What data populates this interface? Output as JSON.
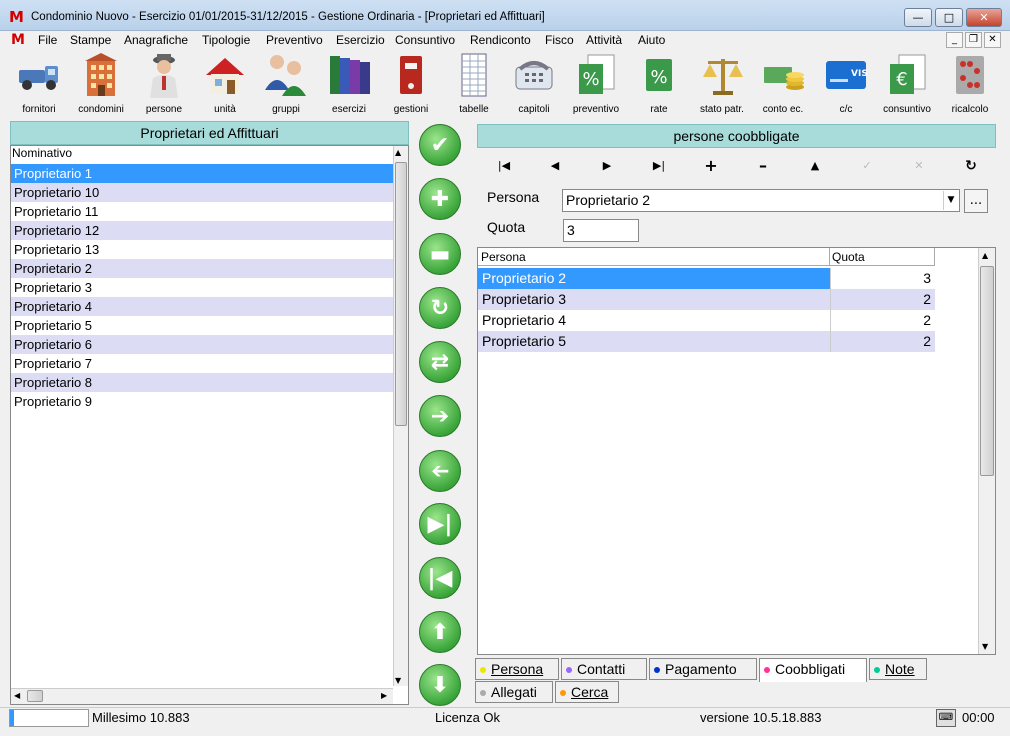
{
  "window": {
    "title": "Condominio Nuovo - Esercizio 01/01/2015-31/12/2015 - Gestione Ordinaria - [Proprietari ed Affittuari]",
    "logo": "M"
  },
  "menu": {
    "items": [
      "File",
      "Stampe",
      "Anagrafiche",
      "Tipologie",
      "Preventivo",
      "Esercizio",
      "Consuntivo",
      "Rendiconto",
      "Fisco",
      "Attività",
      "Aiuto"
    ]
  },
  "toolbar": {
    "items": [
      {
        "label": "fornitori",
        "icon": "truck-icon"
      },
      {
        "label": "condomini",
        "icon": "building-icon"
      },
      {
        "label": "persone",
        "icon": "person-icon"
      },
      {
        "label": "unità",
        "icon": "house-icon"
      },
      {
        "label": "gruppi",
        "icon": "group-icon"
      },
      {
        "label": "esercizi",
        "icon": "books-icon"
      },
      {
        "label": "gestioni",
        "icon": "binder-icon"
      },
      {
        "label": "tabelle",
        "icon": "table-icon"
      },
      {
        "label": "capitoli",
        "icon": "phone-icon"
      },
      {
        "label": "preventivo",
        "icon": "percent-doc-icon"
      },
      {
        "label": "rate",
        "icon": "percent-icon"
      },
      {
        "label": "stato patr.",
        "icon": "scale-icon"
      },
      {
        "label": "conto ec.",
        "icon": "coins-icon"
      },
      {
        "label": "c/c",
        "icon": "visa-card-icon"
      },
      {
        "label": "consuntivo",
        "icon": "euro-doc-icon"
      },
      {
        "label": "ricalcolo",
        "icon": "abacus-icon"
      }
    ]
  },
  "left_panel": {
    "title": "Proprietari ed Affittuari",
    "column_header": "Nominativo",
    "rows": [
      "Proprietario 1",
      "Proprietario 10",
      "Proprietario 11",
      "Proprietario 12",
      "Proprietario 13",
      "Proprietario 2",
      "Proprietario 3",
      "Proprietario 4",
      "Proprietario 5",
      "Proprietario 6",
      "Proprietario 7",
      "Proprietario 8",
      "Proprietario 9"
    ]
  },
  "right_panel": {
    "title": "persone coobbligate",
    "persona_label": "Persona",
    "persona_value": "Proprietario 2",
    "browse_label": "...",
    "quota_label": "Quota",
    "quota_value": "3",
    "grid": {
      "headers": [
        "Persona",
        "Quota"
      ],
      "rows": [
        {
          "persona": "Proprietario 2",
          "quota": "3"
        },
        {
          "persona": "Proprietario 3",
          "quota": "2"
        },
        {
          "persona": "Proprietario 4",
          "quota": "2"
        },
        {
          "persona": "Proprietario 5",
          "quota": "2"
        }
      ]
    }
  },
  "tabs": {
    "row1": [
      {
        "label": "Persona",
        "color": "#e8e800"
      },
      {
        "label": "Contatti",
        "color": "#9966ff"
      },
      {
        "label": "Pagamento",
        "color": "#0033cc"
      },
      {
        "label": "Coobbligati",
        "color": "#ff3399"
      },
      {
        "label": "Note",
        "color": "#00cc99"
      }
    ],
    "row2": [
      {
        "label": "Allegati",
        "color": "#aaaaaa"
      },
      {
        "label": "Cerca",
        "color": "#ff9900"
      }
    ]
  },
  "status": {
    "millesimo": "Millesimo 10.883",
    "licenza": "Licenza Ok",
    "versione": "versione 10.5.18.883",
    "time": "00:00"
  },
  "colors": {
    "panel_header": "#a8dcdb",
    "selection": "#3399ff",
    "alt_row": "#dcdcf4",
    "button_green": "#3aa53a"
  }
}
